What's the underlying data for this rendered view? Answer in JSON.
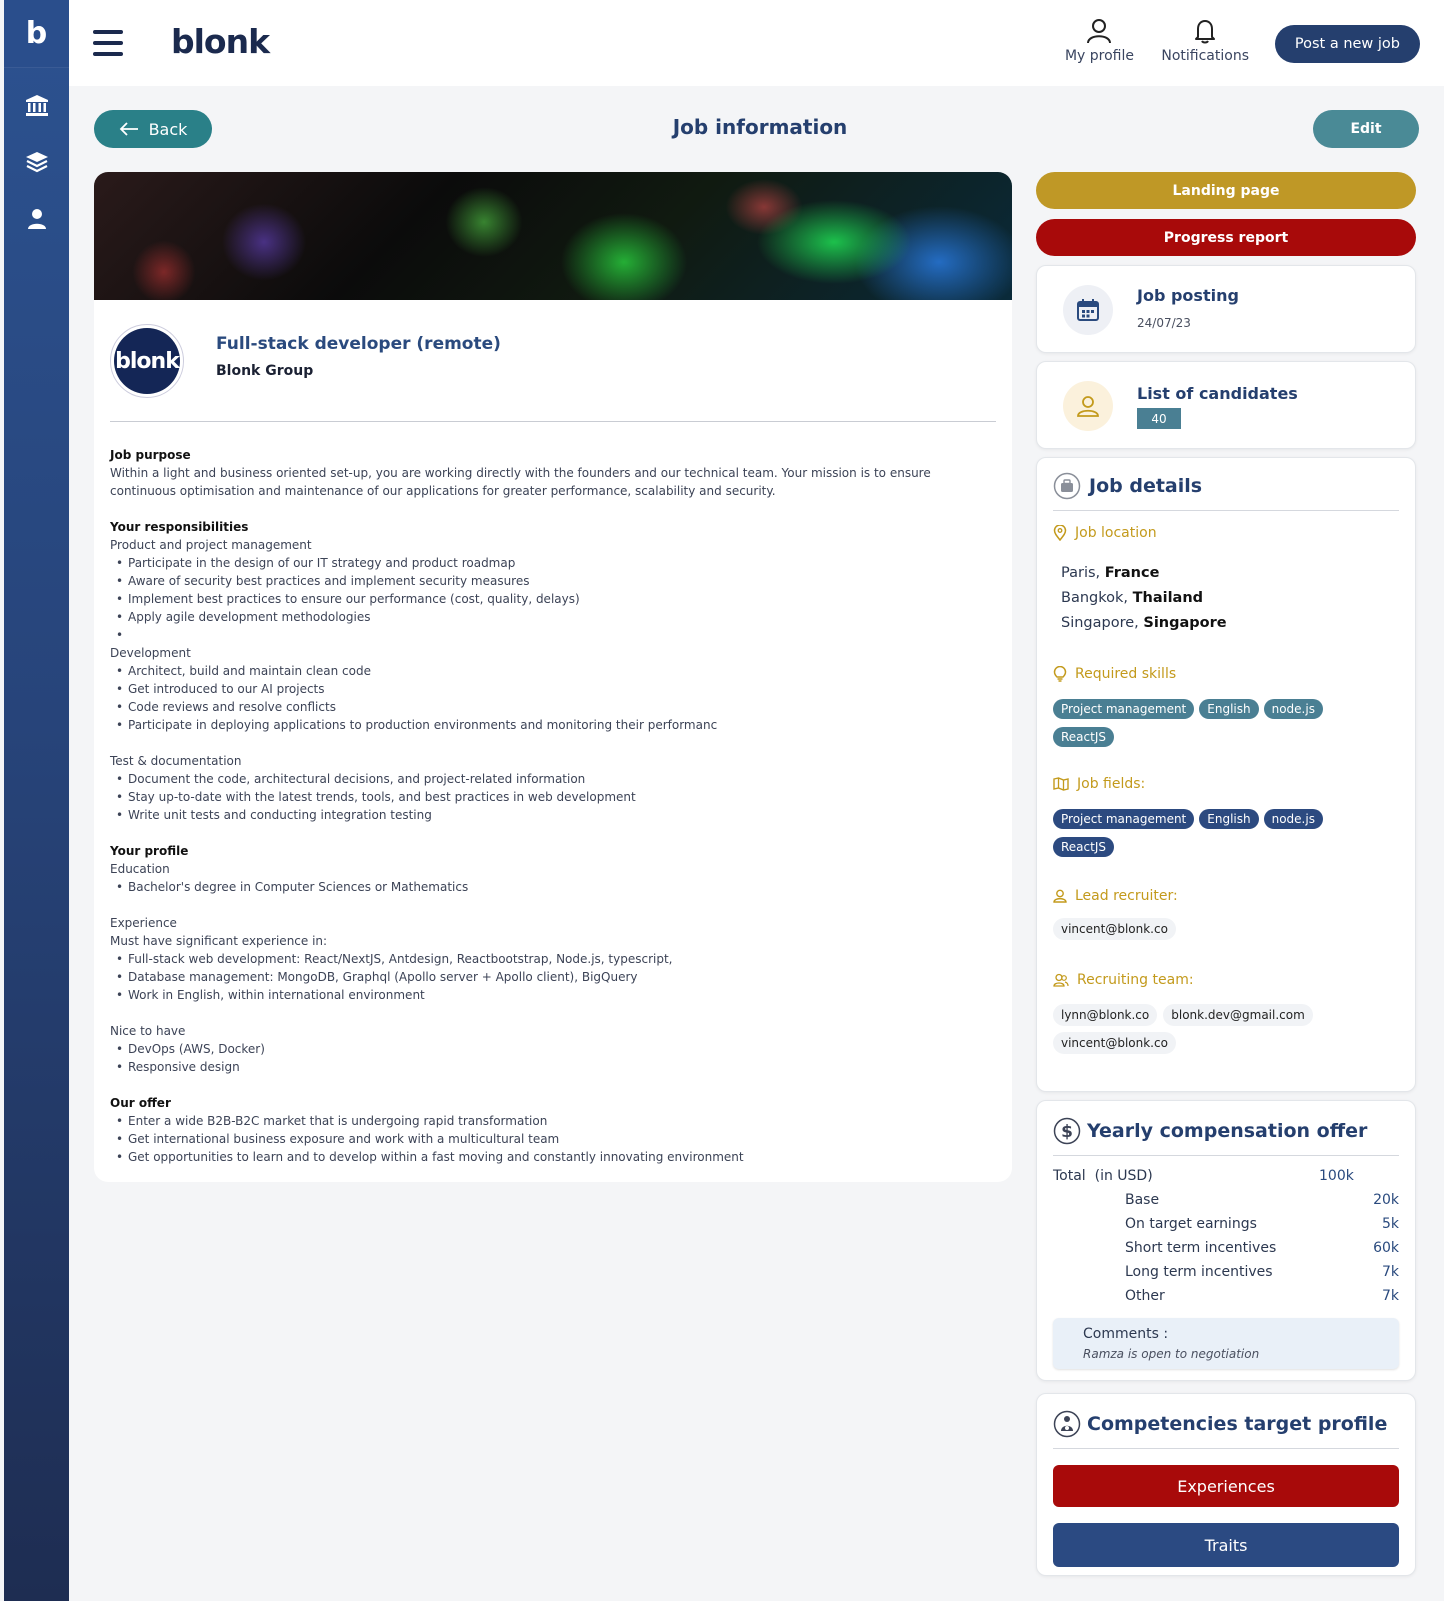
{
  "app": {
    "rail_logo": "b",
    "brand": "blonk"
  },
  "topbar": {
    "my_profile": "My profile",
    "notifications": "Notifications",
    "post_job": "Post a new job"
  },
  "page": {
    "back": "Back",
    "title": "Job information",
    "edit": "Edit"
  },
  "job": {
    "logo_text": "blonk",
    "title": "Full-stack developer (remote)",
    "company": "Blonk Group",
    "purpose_title": "Job purpose",
    "purpose_text": "Within a light and business oriented set-up, you are working directly with the founders and our technical team. Your mission is to ensure continuous optimisation and maintenance of our applications for greater performance, scalability and security.",
    "resp_title": "Your responsibilities",
    "resp_sub1": "Product and project management",
    "resp_list1": [
      "Participate in the design of our IT strategy and product roadmap",
      "Aware of security best practices and implement security measures",
      "Implement best practices to ensure our performance (cost, quality, delays)",
      "Apply agile development methodologies",
      ""
    ],
    "resp_sub2": "Development",
    "resp_list2": [
      "Architect, build and maintain clean code",
      "Get introduced to our AI projects",
      "Code reviews and resolve conflicts",
      "Participate in deploying applications to production environments and monitoring their performanc"
    ],
    "resp_sub3": "Test & documentation",
    "resp_list3": [
      "Document the code, architectural decisions, and project-related information",
      "Stay up-to-date with the latest trends, tools, and best practices in web development",
      "Write unit tests and conducting integration testing"
    ],
    "profile_title": "Your profile",
    "profile_sub1": "Education",
    "profile_list1": [
      "Bachelor's degree in Computer Sciences or Mathematics"
    ],
    "profile_sub2": "Experience",
    "profile_sub2b": "Must have significant experience in:",
    "profile_list2": [
      "Full-stack web development: React/NextJS, Antdesign, Reactbootstrap, Node.js, typescript,",
      "Database management: MongoDB, Graphql (Apollo server + Apollo client), BigQuery",
      "Work in English, within international environment"
    ],
    "profile_sub3": "Nice to have",
    "profile_list3": [
      "DevOps (AWS, Docker)",
      "Responsive design"
    ],
    "offer_title": "Our offer",
    "offer_list": [
      "Enter a wide B2B-B2C market that is undergoing rapid transformation",
      "Get international business exposure and work with a multicultural team",
      "Get opportunities to learn and to develop within a fast moving and constantly innovating environment"
    ]
  },
  "side": {
    "landing_page": "Landing page",
    "progress_report": "Progress report",
    "job_posting": "Job posting",
    "job_posting_date": "24/07/23",
    "candidates": "List of candidates",
    "candidates_count": "40",
    "details_title": "Job details",
    "location_title": "Job location",
    "locations": [
      {
        "city": "Paris,",
        "country": "France"
      },
      {
        "city": "Bangkok,",
        "country": "Thailand"
      },
      {
        "city": "Singapore,",
        "country": "Singapore"
      }
    ],
    "skills_title": "Required skills",
    "skills": [
      "Project management",
      "English",
      "node.js",
      "ReactJS"
    ],
    "fields_title": "Job fields:",
    "fields": [
      "Project management",
      "English",
      "node.js",
      "ReactJS"
    ],
    "lead_title": "Lead recruiter:",
    "lead": "vincent@blonk.co",
    "team_title": "Recruiting team:",
    "team": [
      "lynn@blonk.co",
      "blonk.dev@gmail.com",
      "vincent@blonk.co"
    ],
    "comp_title": "Yearly compensation offer",
    "comp_total_label": "Total",
    "comp_unit": "(in USD)",
    "comp_total": "100k",
    "comp_rows": [
      {
        "label": "Base",
        "value": "20k"
      },
      {
        "label": "On target earnings",
        "value": "5k"
      },
      {
        "label": "Short term incentives",
        "value": "60k"
      },
      {
        "label": "Long term incentives",
        "value": "7k"
      },
      {
        "label": "Other",
        "value": "7k"
      }
    ],
    "comments_label": "Comments :",
    "comments_text": "Ramza is open to negotiation",
    "competencies_title": "Competencies target profile",
    "experiences": "Experiences",
    "traits": "Traits"
  },
  "colors": {
    "navy": "#253f6e",
    "teal": "#2a8088",
    "gold": "#bf9826",
    "red": "#a80a0a"
  }
}
